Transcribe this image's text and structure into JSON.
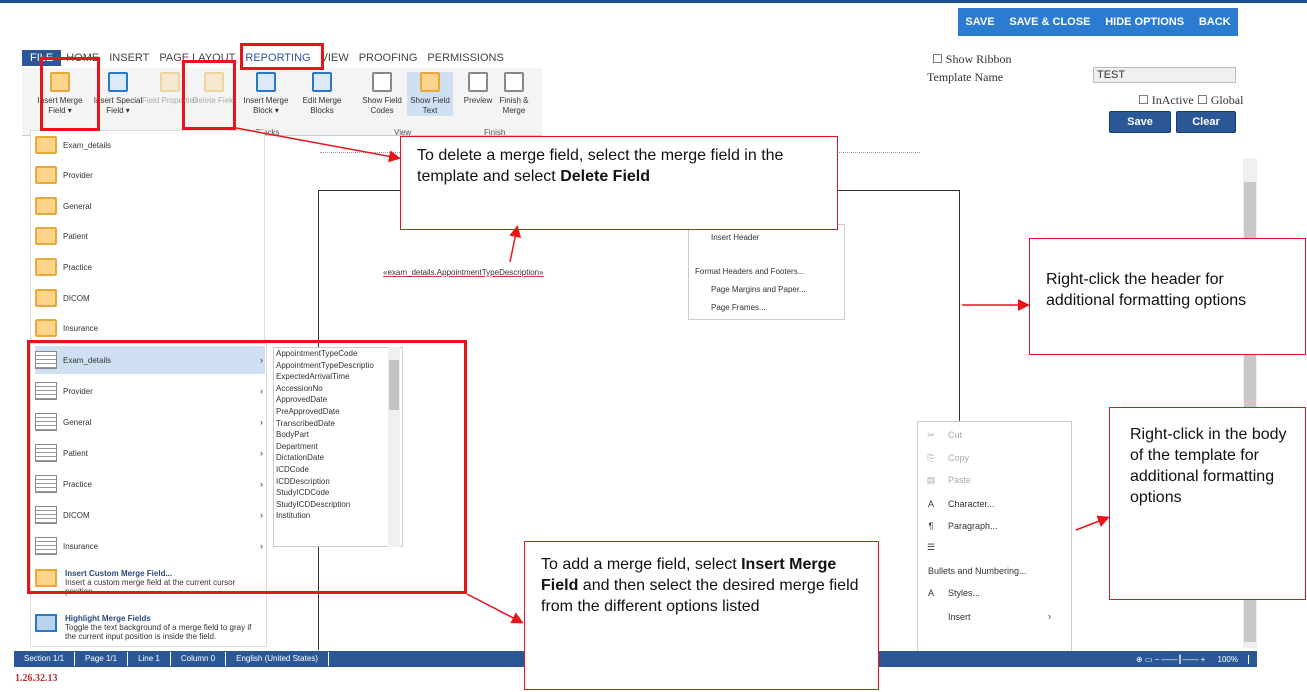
{
  "top_buttons": [
    "SAVE",
    "SAVE & CLOSE",
    "HIDE OPTIONS",
    "BACK"
  ],
  "tabs": [
    "FILE",
    "HOME",
    "INSERT",
    "PAGE LAYOUT",
    "REPORTING",
    "VIEW",
    "PROOFING",
    "PERMISSIONS"
  ],
  "ribbon": {
    "insert_merge_field": "Insert Merge Field ▾",
    "insert_special_field": "Insert Special Field ▾",
    "field_properties": "Field Properties",
    "delete_field": "Delete Field",
    "insert_merge_block": "Insert Merge Block ▾",
    "edit_merge_blocks": "Edit Merge Blocks",
    "show_field_codes": "Show Field Codes",
    "show_field_text": "Show Field Text",
    "preview": "Preview",
    "finish_merge": "Finish & Merge",
    "group_merge_blocks": "rge Blocks",
    "group_view": "View",
    "group_finish": "Finish"
  },
  "right_panel": {
    "show_ribbon": "Show Ribbon",
    "template_name_label": "Template Name",
    "template_name_value": "TEST",
    "inactive": "InActive",
    "global": "Global",
    "save": "Save",
    "clear": "Clear"
  },
  "field_list": [
    "Exam_details",
    "Provider",
    "General",
    "Patient",
    "Practice",
    "DICOM",
    "Insurance"
  ],
  "block_list": [
    "Exam_details",
    "Provider",
    "General",
    "Patient",
    "Practice",
    "DICOM",
    "Insurance"
  ],
  "custom": {
    "insert_title": "Insert Custom Merge Field...",
    "insert_desc": "Insert a custom merge field at the current cursor position.",
    "highlight_title": "Highlight Merge Fields",
    "highlight_desc": "Toggle the text background of a merge field to gray if the current input position is inside the field."
  },
  "submenu": [
    "AppointmentTypeCode",
    "AppointmentTypeDescriptio",
    "ExpectedArrivalTime",
    "AccessionNo",
    "ApprovedDate",
    "PreApprovedDate",
    "TranscribedDate",
    "BodyPart",
    "Department",
    "DictationDate",
    "ICDCode",
    "ICDDescription",
    "StudyICDCode",
    "StudyICDDescription",
    "Institution"
  ],
  "document_text": "«exam_details.AppointmentTypeDescription»",
  "header_menu": [
    "Insert Header",
    "Format Headers and Footers...",
    "Page Margins and Paper...",
    "Page Frames..."
  ],
  "context_menu": [
    "Cut",
    "Copy",
    "Paste",
    "Character...",
    "Paragraph...",
    "Bullets and Numbering...",
    "Styles...",
    "Insert"
  ],
  "status": [
    "Section 1/1",
    "Page 1/1",
    "Line 1",
    "Column 0",
    "English (United States)"
  ],
  "zoom": "100%",
  "version": "1.26.32.13",
  "callouts": {
    "delete_pre": "To delete a merge field, select the merge field in the template and select ",
    "delete_bold": "Delete Field",
    "header": "Right-click the header for additional formatting options",
    "body": "Right-click in the body of the template for additional formatting options",
    "add_pre": "To add a merge field, select ",
    "add_bold": "Insert Merge Field",
    "add_post": " and then select the desired merge field from the different options listed"
  },
  "colors": {
    "accent": "#2b5797",
    "annotation": "#e8141c"
  }
}
